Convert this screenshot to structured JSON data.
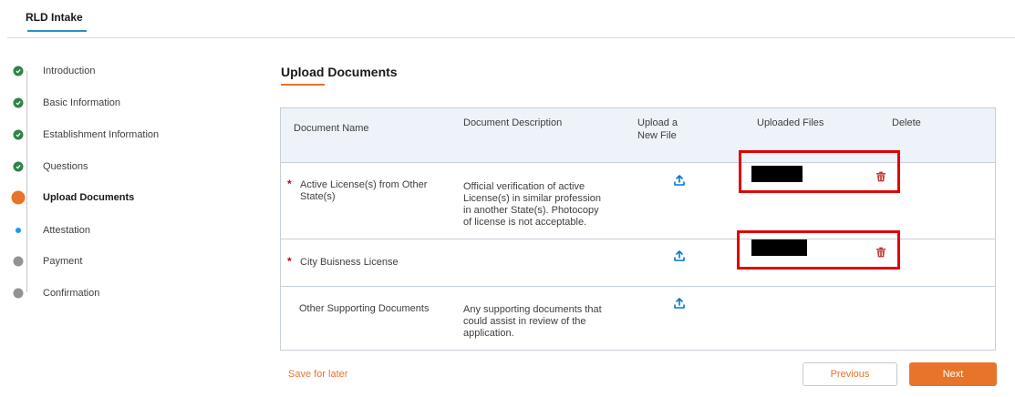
{
  "header": {
    "tab_label": "RLD Intake"
  },
  "steps": [
    {
      "label": "Introduction",
      "status": "complete"
    },
    {
      "label": "Basic Information",
      "status": "complete"
    },
    {
      "label": "Establishment Information",
      "status": "complete"
    },
    {
      "label": "Questions",
      "status": "complete"
    },
    {
      "label": "Upload Documents",
      "status": "current"
    },
    {
      "label": "Attestation",
      "status": "next"
    },
    {
      "label": "Payment",
      "status": "future"
    },
    {
      "label": "Confirmation",
      "status": "future"
    }
  ],
  "section": {
    "title": "Upload Documents"
  },
  "table": {
    "headers": {
      "name": "Document Name",
      "description": "Document Description",
      "upload_line1": "Upload a",
      "upload_line2": "New File",
      "uploaded": "Uploaded Files",
      "delete": "Delete"
    },
    "rows": [
      {
        "required": "*",
        "name_line1": "Active License(s) from Other",
        "name_line2": "State(s)",
        "desc_lines": [
          "Official verification of active",
          "License(s) in similar profession",
          "in another State(s). Photocopy",
          "of license is not acceptable."
        ]
      },
      {
        "required": "*",
        "name_line1": "City Buisness License",
        "desc_lines": []
      },
      {
        "required": "",
        "name_line1": "Other Supporting Documents",
        "desc_lines": [
          "Any supporting documents that",
          "could assist in review of the",
          "application."
        ]
      }
    ]
  },
  "footer": {
    "save_label": "Save for later",
    "previous_label": "Previous",
    "next_label": "Next"
  },
  "colors": {
    "accent": "#e8742b",
    "complete": "#2e844a",
    "next_step": "#1b96ff",
    "required": "#ba0517",
    "highlight": "#e00000",
    "upload_icon": "#0176d3",
    "trash_icon": "#c23934"
  },
  "icons": {
    "complete_step": "check-circle-icon",
    "upload": "upload-icon",
    "delete": "trash-icon"
  }
}
